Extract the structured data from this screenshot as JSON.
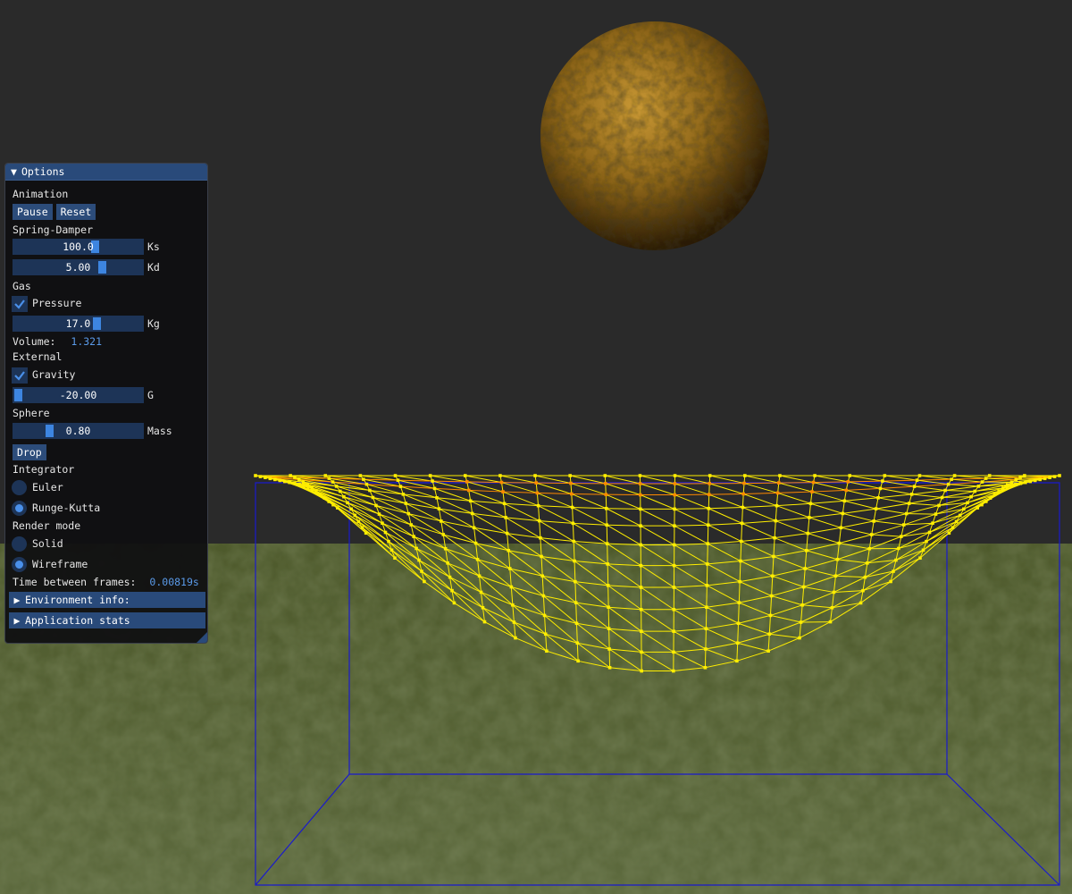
{
  "panel": {
    "title": "Options",
    "sections": {
      "animation": "Animation",
      "spring": "Spring-Damper",
      "gas": "Gas",
      "external": "External",
      "sphere": "Sphere",
      "integrator": "Integrator",
      "render_mode": "Render mode"
    },
    "buttons": {
      "pause": "Pause",
      "reset": "Reset",
      "drop": "Drop"
    },
    "sliders": {
      "ks": {
        "value": "100.0",
        "label": "Ks",
        "level": 0.64
      },
      "kd": {
        "value": "5.00",
        "label": "Kd",
        "level": 0.7
      },
      "kg": {
        "value": "17.0",
        "label": "Kg",
        "level": 0.66
      },
      "g": {
        "value": "-20.00",
        "label": "G",
        "level": 0.0
      },
      "mass": {
        "value": "0.80",
        "label": "Mass",
        "level": 0.26
      }
    },
    "checkboxes": {
      "pressure": "Pressure",
      "gravity": "Gravity"
    },
    "volume": {
      "label": "Volume:",
      "value": "1.321"
    },
    "radios": {
      "euler": "Euler",
      "runge_kutta": "Runge-Kutta",
      "solid": "Solid",
      "wireframe": "Wireframe"
    },
    "frame_time": {
      "label": "Time between frames:",
      "value": "0.00819s"
    },
    "collapsed": {
      "env_info": "Environment info:",
      "app_stats": "Application stats"
    }
  },
  "colors": {
    "sky": "#2a2a2a",
    "ground": "#4f5a32",
    "wire": "#ffee00",
    "wire_hot": "#ff8a00",
    "box": "#1a1acc",
    "sphere": "#a87a25",
    "accent": "#3d85e0"
  },
  "icons": [
    "triangle-down-icon",
    "triangle-right-icon",
    "checkmark-icon"
  ]
}
